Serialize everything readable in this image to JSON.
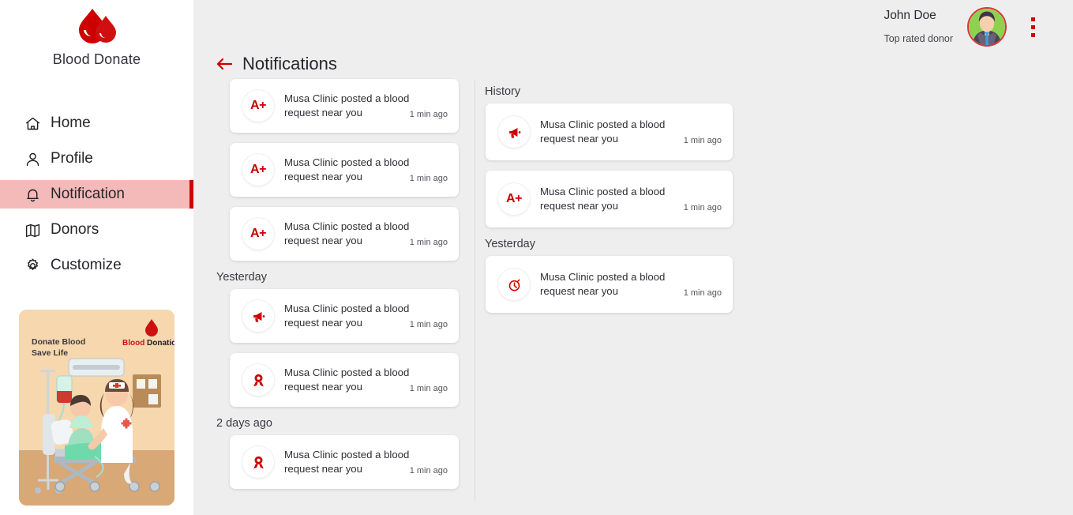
{
  "brand": {
    "name": "Blood Donate",
    "logo_icon": "blood-drop-icon"
  },
  "colors": {
    "accent_red": "#cc0000",
    "active_nav_bg": "#f4b9b9",
    "active_nav_bar": "#ce0000",
    "main_bg": "#eeeeee",
    "card_bg": "#ffffff"
  },
  "sidebar": {
    "items": [
      {
        "label": "Home",
        "icon": "home-icon",
        "active": false
      },
      {
        "label": "Profile",
        "icon": "user-icon",
        "active": false
      },
      {
        "label": "Notification",
        "icon": "bell-icon",
        "active": true
      },
      {
        "label": "Donors",
        "icon": "map-icon",
        "active": false
      },
      {
        "label": "Customize",
        "icon": "gear-icon",
        "active": false
      }
    ],
    "promo": {
      "headline_line1": "Donate Blood",
      "headline_line2": "Save Life",
      "badge_word1": "Blood",
      "badge_word2": "Donation",
      "icon": "hospital-bed-illustration"
    }
  },
  "topbar": {
    "user_name": "John Doe",
    "user_subtitle": "Top rated donor",
    "avatar_icon": "user-avatar",
    "menu_icon": "kebab-menu-icon"
  },
  "page": {
    "back_icon": "back-arrow-icon",
    "title": "Notifications"
  },
  "notifications": {
    "left_column": {
      "groups": [
        {
          "label": "",
          "items": [
            {
              "badge": "A+",
              "icon": "blood-type-icon",
              "text": "Musa Clinic posted a blood request near you",
              "time": "1 min ago"
            },
            {
              "badge": "A+",
              "icon": "blood-type-icon",
              "text": "Musa Clinic posted a blood request near you",
              "time": "1 min ago"
            },
            {
              "badge": "A+",
              "icon": "blood-type-icon",
              "text": "Musa Clinic posted a blood request near you",
              "time": "1 min ago"
            }
          ]
        },
        {
          "label": "Yesterday",
          "items": [
            {
              "badge": "",
              "icon": "megaphone-icon",
              "text": "Musa Clinic posted a blood request near you",
              "time": "1 min ago"
            },
            {
              "badge": "",
              "icon": "award-icon",
              "text": "Musa Clinic posted a blood request near you",
              "time": "1 min ago"
            }
          ]
        },
        {
          "label": "2 days ago",
          "items": [
            {
              "badge": "",
              "icon": "award-icon",
              "text": "Musa Clinic posted a blood request near you",
              "time": "1 min ago"
            }
          ]
        }
      ]
    },
    "right_column": {
      "groups": [
        {
          "label": "History",
          "items": [
            {
              "badge": "",
              "icon": "megaphone-icon",
              "text": "Musa Clinic posted a blood request near you",
              "time": "1 min ago"
            },
            {
              "badge": "A+",
              "icon": "blood-type-icon",
              "text": "Musa Clinic posted a blood request near you",
              "time": "1 min ago"
            }
          ]
        },
        {
          "label": "Yesterday",
          "items": [
            {
              "badge": "",
              "icon": "stopwatch-icon",
              "text": "Musa Clinic posted a blood request near you",
              "time": "1 min ago"
            }
          ]
        }
      ]
    }
  }
}
